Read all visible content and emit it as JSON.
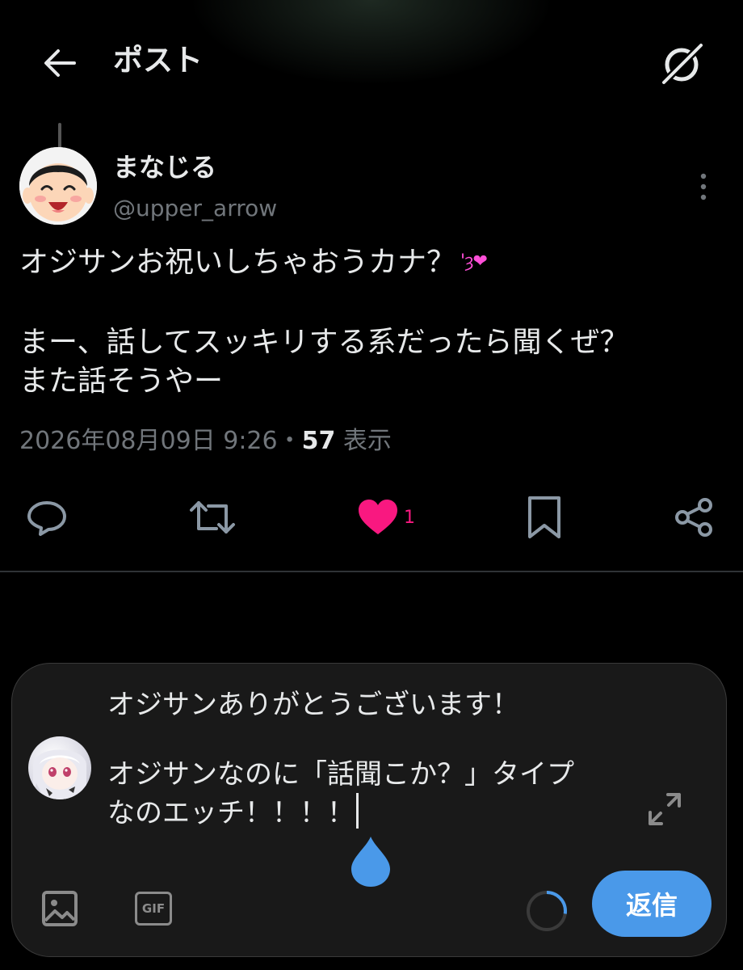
{
  "header": {
    "title": "ポスト",
    "back_icon": "arrow-left-icon",
    "grok_icon": "grok-icon"
  },
  "post": {
    "author": {
      "display_name": "まなじる",
      "handle": "@upper_arrow"
    },
    "text": {
      "line1": "オジサンお祝いしちゃおうカナ？",
      "emoji": "'ȝ❤",
      "line2": "まー、話してスッキリする系だったら聞くぜ？",
      "line3": "また話そうやー"
    },
    "timestamp": "2026年08月09日 9:26",
    "separator": "・",
    "views_count": "57",
    "views_label": "表示",
    "like_count": "1",
    "colors": {
      "like": "#f91880",
      "muted": "#71767b"
    }
  },
  "composer": {
    "reply_text": {
      "line1": "オジサンありがとうございます！",
      "line2": "オジサンなのに「話聞こか？」タイプ",
      "line3": "なのエッチ！！！！"
    },
    "gif_label": "GIF",
    "reply_button_label": "返信",
    "colors": {
      "accent": "#4a99e9"
    }
  }
}
